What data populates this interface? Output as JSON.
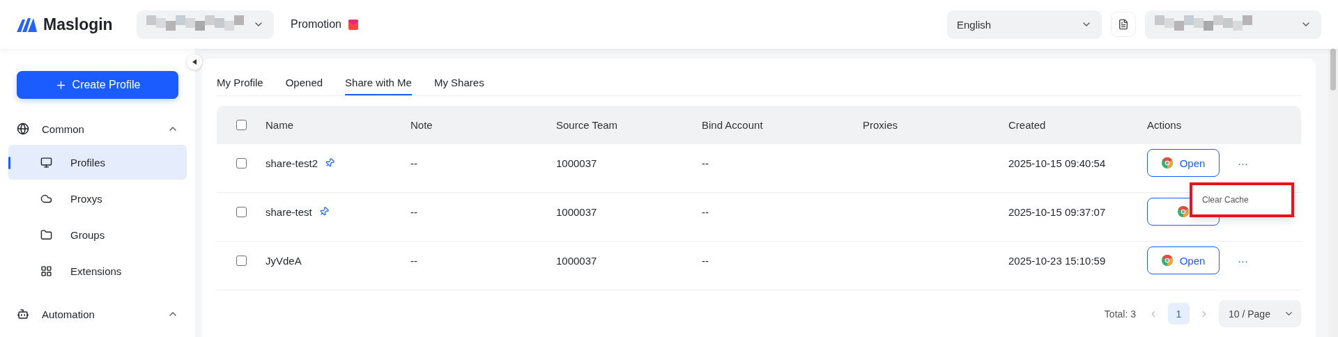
{
  "header": {
    "brand": "Maslogin",
    "promotion": "Promotion",
    "language": "English"
  },
  "sidebar": {
    "create_button": "Create Profile",
    "sections": [
      {
        "label": "Common",
        "expanded": true,
        "children": [
          {
            "label": "Profiles",
            "selected": true
          },
          {
            "label": "Proxys",
            "selected": false
          },
          {
            "label": "Groups",
            "selected": false
          },
          {
            "label": "Extensions",
            "selected": false
          }
        ]
      },
      {
        "label": "Automation",
        "expanded": true
      }
    ]
  },
  "tabs": [
    {
      "label": "My Profile",
      "selected": false
    },
    {
      "label": "Opened",
      "selected": false
    },
    {
      "label": "Share with Me",
      "selected": true
    },
    {
      "label": "My Shares",
      "selected": false
    }
  ],
  "table": {
    "columns": [
      "Name",
      "Note",
      "Source Team",
      "Bind Account",
      "Proxies",
      "Created",
      "Actions"
    ],
    "header_checked": false,
    "rows": [
      {
        "checked": false,
        "name": "share-test2",
        "pinned": true,
        "note": "--",
        "source_team": "1000037",
        "bind_account": "--",
        "created": "2025-10-15 09:40:54",
        "open": "Open",
        "more": "···",
        "menu": [
          "Clear Cache"
        ]
      },
      {
        "checked": false,
        "name": "share-test",
        "pinned": true,
        "note": "--",
        "source_team": "1000037",
        "bind_account": "--",
        "created": "2025-10-15 09:37:07"
      },
      {
        "checked": false,
        "name": "JyVdeA",
        "pinned": false,
        "note": "--",
        "source_team": "1000037",
        "bind_account": "--",
        "created": "2025-10-23 15:10:59",
        "open": "Open",
        "more": "···"
      }
    ]
  },
  "pagination": {
    "total": "Total: 3",
    "pages": [
      {
        "label": "1",
        "selected": true
      }
    ],
    "page_size": "10 / Page"
  }
}
